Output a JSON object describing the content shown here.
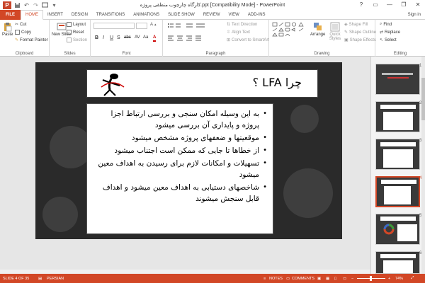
{
  "window": {
    "title": "کارگاه چارچوب منطقی پروژه.ppt [Compatibility Mode] - PowerPoint",
    "min": "—",
    "restore": "❐",
    "close": "✕",
    "help": "?"
  },
  "tabs": {
    "file": "FILE",
    "items": [
      "HOME",
      "INSERT",
      "DESIGN",
      "TRANSITIONS",
      "ANIMATIONS",
      "SLIDE SHOW",
      "REVIEW",
      "VIEW",
      "ADD-INS"
    ],
    "sign_in": "Sign in"
  },
  "ribbon": {
    "clipboard": {
      "label": "Clipboard",
      "paste": "Paste",
      "cut": "Cut",
      "copy": "Copy",
      "format_painter": "Format Painter"
    },
    "slides": {
      "label": "Slides",
      "new_slide": "New Slide",
      "layout": "Layout",
      "reset": "Reset",
      "section": "Section"
    },
    "font": {
      "label": "Font",
      "bold": "B",
      "italic": "I",
      "underline": "U",
      "strike": "S",
      "abc": "abc",
      "av": "AV",
      "aa": "Aa",
      "color": "A"
    },
    "paragraph": {
      "label": "Paragraph",
      "text_direction": "Text Direction",
      "align_text": "Align Text",
      "convert_smartart": "Convert to SmartArt"
    },
    "drawing": {
      "label": "Drawing",
      "arrange": "Arrange",
      "quick_styles": "Quick Styles",
      "shape_fill": "Shape Fill",
      "shape_outline": "Shape Outline",
      "shape_effects": "Shape Effects"
    },
    "editing": {
      "label": "Editing",
      "find": "Find",
      "replace": "Replace",
      "select": "Select"
    }
  },
  "slide": {
    "title": "چرا LFA ؟",
    "bullets": [
      "به این وسیله امکان سنجی و بررسی ارتباط اجزا پروژه و پایداری آن بررسی میشود",
      "موقعیتها و ضعفهای پروژه مشخص میشود",
      "از خطاها تا جایی که ممکن است اجتناب میشود",
      "تسهیلات و امکانات لازم برای رسیدن به اهداف معین میشود",
      "شاخصهای دستیابی به اهداف معین میشود و اهداف قابل سنجش میشوند"
    ]
  },
  "thumbnails": {
    "numbers": [
      "1",
      "2",
      "3",
      "4",
      "5",
      "6"
    ],
    "selected": 4
  },
  "status": {
    "slide_of": "SLIDE 4 OF 35",
    "language": "PERSIAN",
    "notes": "NOTES",
    "comments": "COMMENTS",
    "zoom": "74%"
  },
  "colors": {
    "accent": "#d24726",
    "slide_bg": "#2a2a2a"
  }
}
